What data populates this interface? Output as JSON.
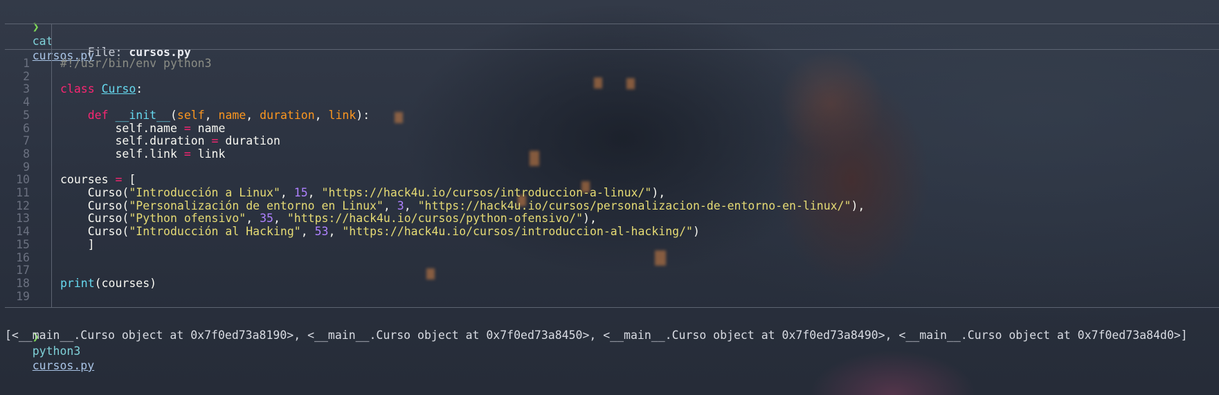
{
  "prompt1": {
    "arrow": "❯",
    "command": "cat",
    "arg": "cursos.py"
  },
  "header": {
    "label": "File: ",
    "filename": "cursos.py"
  },
  "code_lines": [
    {
      "n": "1",
      "tokens": [
        {
          "t": "#!/usr/bin/env python3",
          "k": "comment"
        }
      ]
    },
    {
      "n": "2",
      "tokens": []
    },
    {
      "n": "3",
      "tokens": [
        {
          "t": "class ",
          "k": "kw"
        },
        {
          "t": "Curso",
          "k": "cls"
        },
        {
          "t": ":",
          "k": "plain"
        }
      ]
    },
    {
      "n": "4",
      "tokens": []
    },
    {
      "n": "5",
      "tokens": [
        {
          "t": "    ",
          "k": "plain"
        },
        {
          "t": "def ",
          "k": "kw"
        },
        {
          "t": "__init__",
          "k": "fn"
        },
        {
          "t": "(",
          "k": "plain"
        },
        {
          "t": "self",
          "k": "param"
        },
        {
          "t": ", ",
          "k": "plain"
        },
        {
          "t": "name",
          "k": "param"
        },
        {
          "t": ", ",
          "k": "plain"
        },
        {
          "t": "duration",
          "k": "param"
        },
        {
          "t": ", ",
          "k": "plain"
        },
        {
          "t": "link",
          "k": "param"
        },
        {
          "t": "):",
          "k": "plain"
        }
      ]
    },
    {
      "n": "6",
      "tokens": [
        {
          "t": "        self.name ",
          "k": "plain"
        },
        {
          "t": "=",
          "k": "op"
        },
        {
          "t": " name",
          "k": "plain"
        }
      ]
    },
    {
      "n": "7",
      "tokens": [
        {
          "t": "        self.duration ",
          "k": "plain"
        },
        {
          "t": "=",
          "k": "op"
        },
        {
          "t": " duration",
          "k": "plain"
        }
      ]
    },
    {
      "n": "8",
      "tokens": [
        {
          "t": "        self.link ",
          "k": "plain"
        },
        {
          "t": "=",
          "k": "op"
        },
        {
          "t": " link",
          "k": "plain"
        }
      ]
    },
    {
      "n": "9",
      "tokens": []
    },
    {
      "n": "10",
      "tokens": [
        {
          "t": "courses ",
          "k": "plain"
        },
        {
          "t": "=",
          "k": "op"
        },
        {
          "t": " [",
          "k": "plain"
        }
      ]
    },
    {
      "n": "11",
      "tokens": [
        {
          "t": "    Curso(",
          "k": "plain"
        },
        {
          "t": "\"Introducción a Linux\"",
          "k": "str"
        },
        {
          "t": ", ",
          "k": "plain"
        },
        {
          "t": "15",
          "k": "num"
        },
        {
          "t": ", ",
          "k": "plain"
        },
        {
          "t": "\"https://hack4u.io/cursos/introduccion-a-linux/\"",
          "k": "str"
        },
        {
          "t": "),",
          "k": "plain"
        }
      ]
    },
    {
      "n": "12",
      "tokens": [
        {
          "t": "    Curso(",
          "k": "plain"
        },
        {
          "t": "\"Personalización de entorno en Linux\"",
          "k": "str"
        },
        {
          "t": ", ",
          "k": "plain"
        },
        {
          "t": "3",
          "k": "num"
        },
        {
          "t": ", ",
          "k": "plain"
        },
        {
          "t": "\"https://hack4u.io/cursos/personalizacion-de-entorno-en-linux/\"",
          "k": "str"
        },
        {
          "t": "),",
          "k": "plain"
        }
      ]
    },
    {
      "n": "13",
      "tokens": [
        {
          "t": "    Curso(",
          "k": "plain"
        },
        {
          "t": "\"Python ofensivo\"",
          "k": "str"
        },
        {
          "t": ", ",
          "k": "plain"
        },
        {
          "t": "35",
          "k": "num"
        },
        {
          "t": ", ",
          "k": "plain"
        },
        {
          "t": "\"https://hack4u.io/cursos/python-ofensivo/\"",
          "k": "str"
        },
        {
          "t": "),",
          "k": "plain"
        }
      ]
    },
    {
      "n": "14",
      "tokens": [
        {
          "t": "    Curso(",
          "k": "plain"
        },
        {
          "t": "\"Introducción al Hacking\"",
          "k": "str"
        },
        {
          "t": ", ",
          "k": "plain"
        },
        {
          "t": "53",
          "k": "num"
        },
        {
          "t": ", ",
          "k": "plain"
        },
        {
          "t": "\"https://hack4u.io/cursos/introduccion-al-hacking/\"",
          "k": "str"
        },
        {
          "t": ")",
          "k": "plain"
        }
      ]
    },
    {
      "n": "15",
      "tokens": [
        {
          "t": "    ]",
          "k": "plain"
        }
      ]
    },
    {
      "n": "16",
      "tokens": []
    },
    {
      "n": "17",
      "tokens": []
    },
    {
      "n": "18",
      "tokens": [
        {
          "t": "print",
          "k": "fn"
        },
        {
          "t": "(courses)",
          "k": "plain"
        }
      ]
    },
    {
      "n": "19",
      "tokens": []
    }
  ],
  "prompt2": {
    "arrow": "❯",
    "command": "python3",
    "arg": "cursos.py"
  },
  "output": "[<__main__.Curso object at 0x7f0ed73a8190>, <__main__.Curso object at 0x7f0ed73a8450>, <__main__.Curso object at 0x7f0ed73a8490>, <__main__.Curso object at 0x7f0ed73a84d0>]"
}
